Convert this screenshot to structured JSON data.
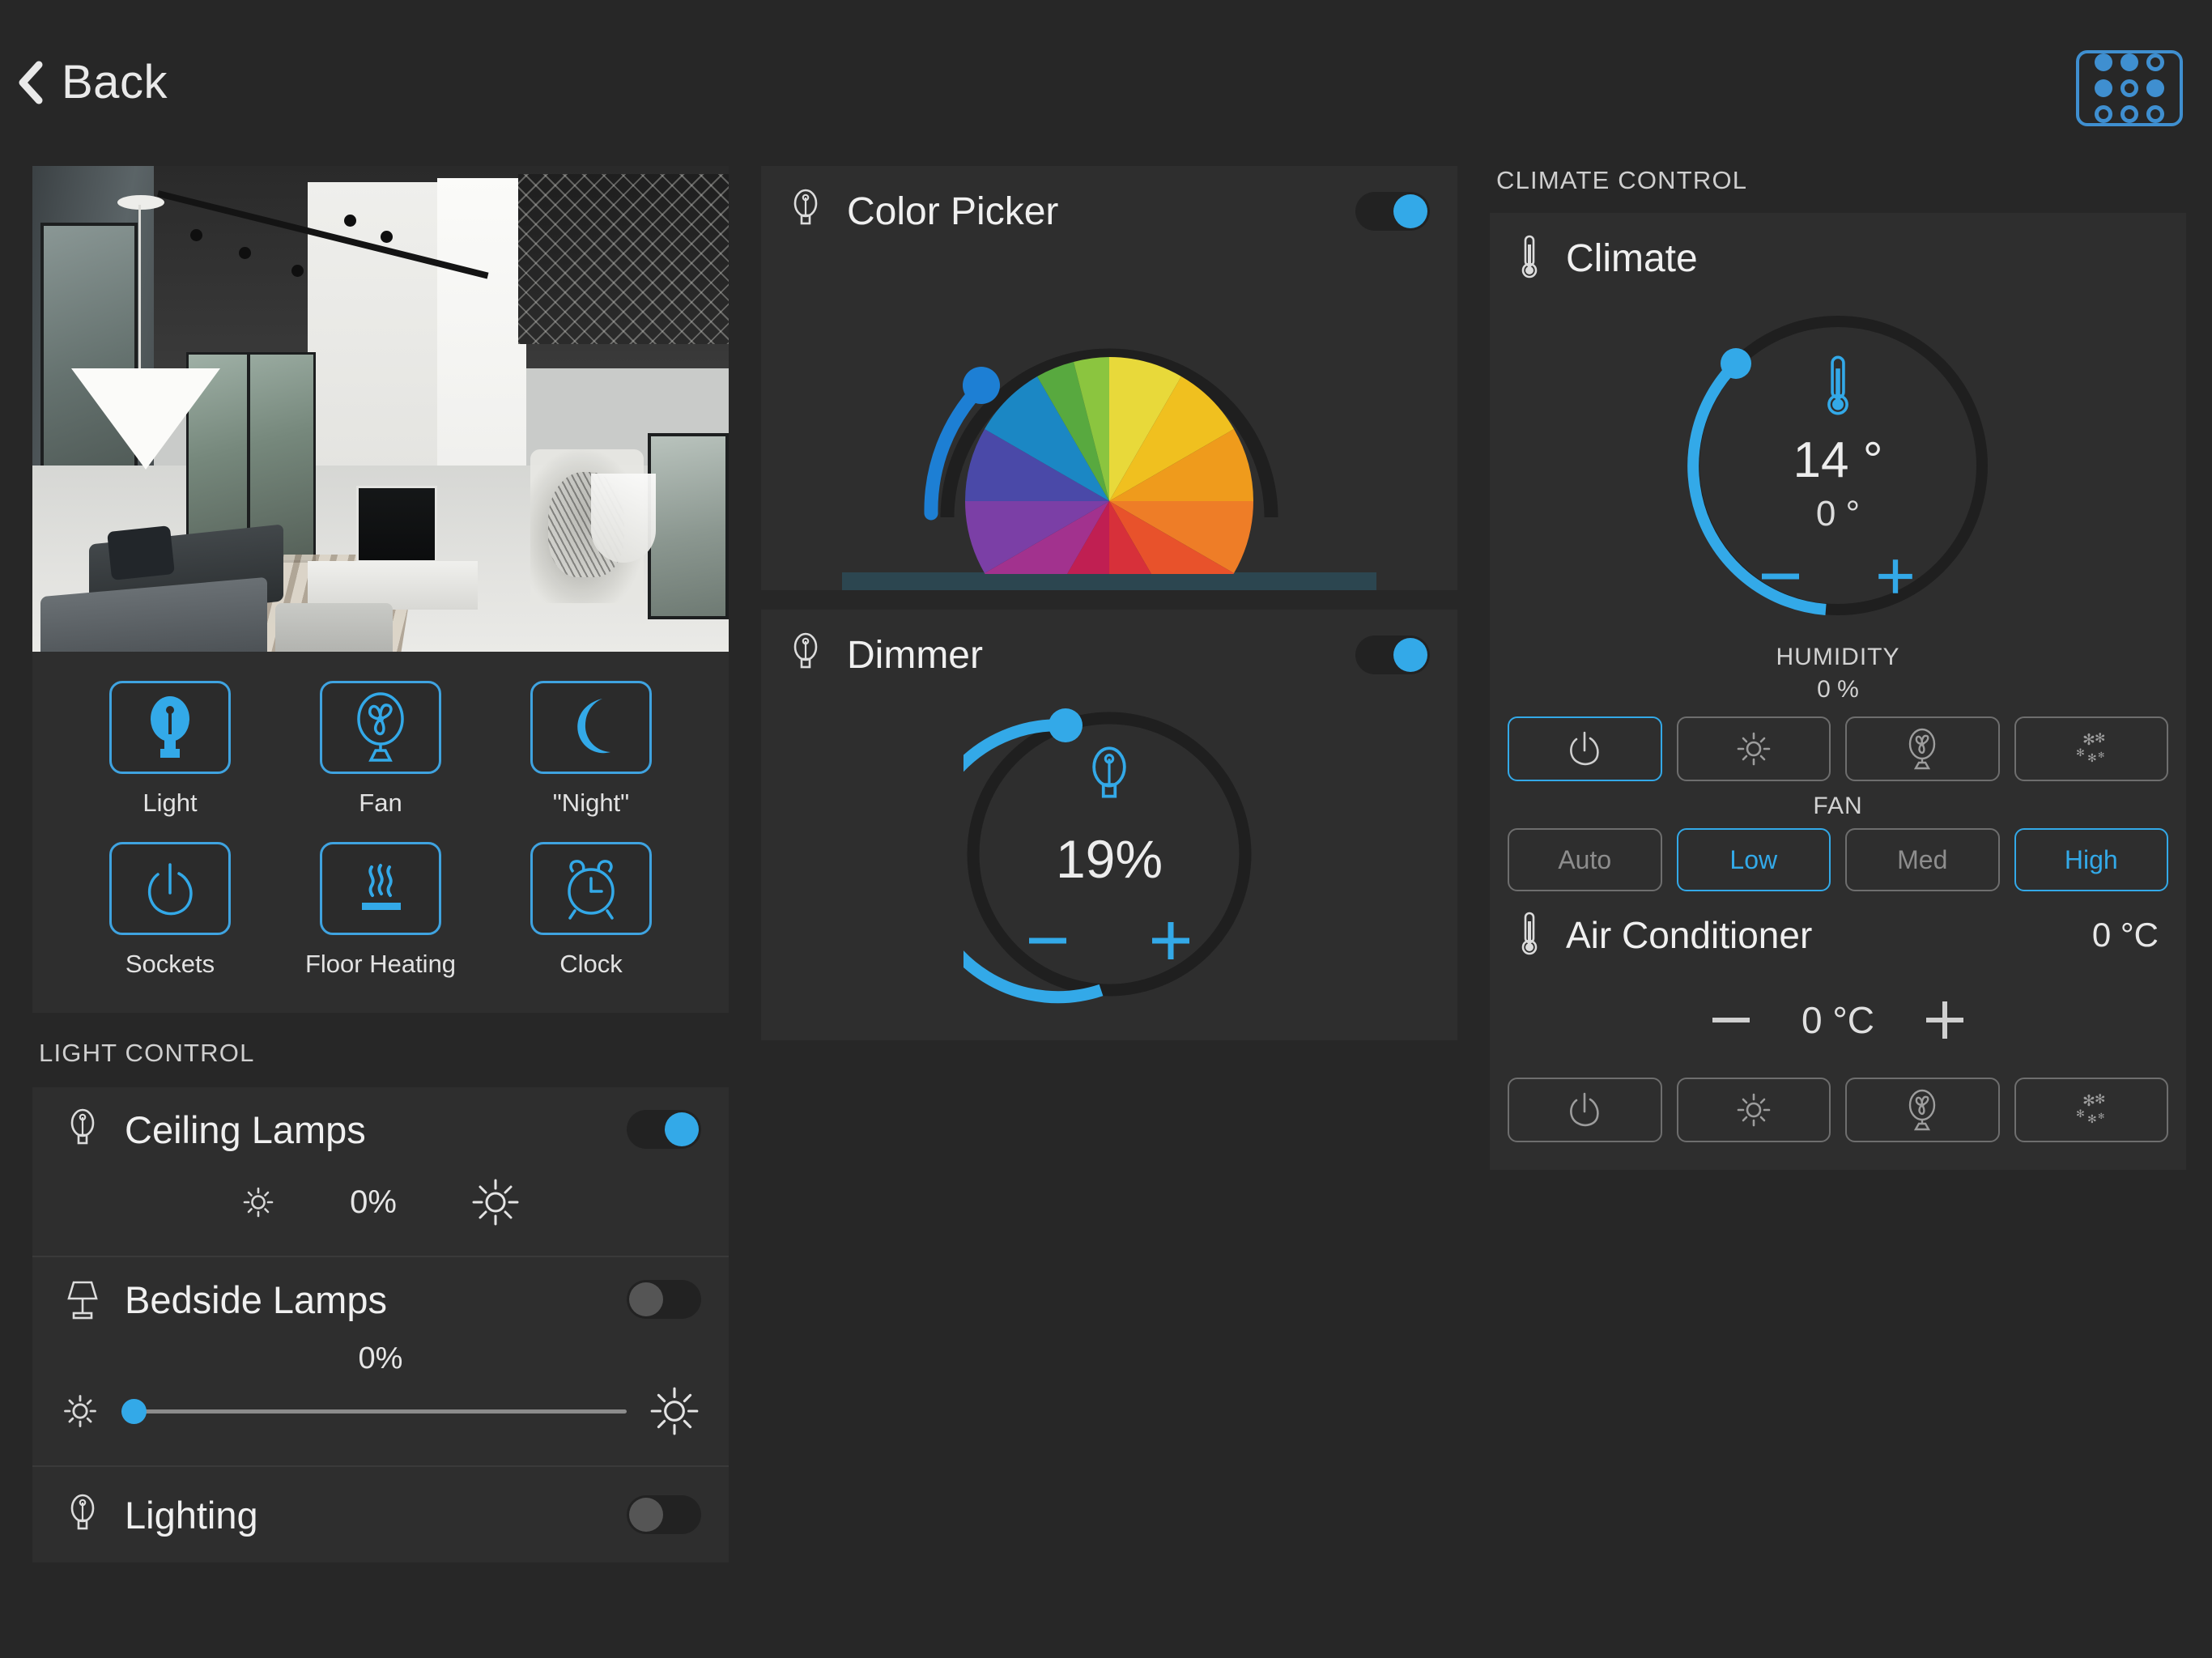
{
  "topbar": {
    "back_label": "Back",
    "back_icon": "chevron-left-icon",
    "grid_icon": "apps-grid-icon",
    "grid_dots": [
      "filled",
      "filled",
      "hollow",
      "filled",
      "hollow",
      "filled",
      "hollow",
      "hollow",
      "hollow"
    ]
  },
  "room_photo": {
    "alt": "modern-living-room-interior",
    "caption": ""
  },
  "quick_actions": [
    {
      "label": "Light",
      "icon": "lightbulb-filled-icon"
    },
    {
      "label": "Fan",
      "icon": "fan-icon"
    },
    {
      "label": "\"Night\"",
      "icon": "moon-icon"
    },
    {
      "label": "Sockets",
      "icon": "power-icon"
    },
    {
      "label": "Floor Heating",
      "icon": "floor-heating-icon"
    },
    {
      "label": "Clock",
      "icon": "alarm-clock-icon"
    }
  ],
  "light_control": {
    "caption": "LIGHT CONTROL",
    "rows": [
      {
        "name": "Ceiling Lamps",
        "icon": "lightbulb-outline-icon",
        "toggle": "on",
        "brightness": "0%",
        "control": "brightness-buttons",
        "dim_low_icon": "brightness-low-icon",
        "dim_high_icon": "brightness-high-icon"
      },
      {
        "name": "Bedside Lamps",
        "icon": "table-lamp-icon",
        "toggle": "off",
        "brightness": "0%",
        "control": "slider",
        "slider_position": 0,
        "dim_low_icon": "brightness-low-icon",
        "dim_high_icon": "brightness-high-icon"
      },
      {
        "name": "Lighting",
        "icon": "lightbulb-outline-icon",
        "toggle": "off",
        "control": "none"
      }
    ]
  },
  "color_picker": {
    "title": "Color Picker",
    "icon": "lightbulb-outline-icon",
    "toggle": "on",
    "wheel_segments": [
      "#e8d93a",
      "#f0c01f",
      "#ef9b1c",
      "#ee7d27",
      "#e8522b",
      "#d7303a",
      "#c01f52",
      "#a2328e",
      "#7b3fa6",
      "#4a49a8",
      "#1b87c4",
      "#58a93f",
      "#8bc53f",
      "#d4d830"
    ],
    "arc_handle_color": "#1d7fd4",
    "arc_track_color": "#1f1f1f",
    "preview_bar_color": "#2c4650"
  },
  "dimmer": {
    "title": "Dimmer",
    "icon": "lightbulb-outline-icon",
    "toggle": "on",
    "value": "19%",
    "value_number": 19,
    "center_icon": "lightbulb-outline-icon",
    "minus_label": "minus-icon",
    "plus_label": "plus-icon",
    "arc_color": "#33a9e8",
    "arc_track_color": "#1f1f1f"
  },
  "climate_control": {
    "caption": "CLIMATE CONTROL",
    "title": "Climate",
    "icon": "thermometer-icon",
    "center_icon": "thermometer-icon",
    "setpoint": "14 °",
    "current": "0 °",
    "minus_label": "minus-icon",
    "plus_label": "plus-icon",
    "humidity_caption": "HUMIDITY",
    "humidity_value": "0 %",
    "mode_buttons": [
      {
        "icon": "power-icon",
        "active": true
      },
      {
        "icon": "sun-icon",
        "active": false
      },
      {
        "icon": "fan-icon",
        "active": false
      },
      {
        "icon": "snowflake-icon",
        "active": false
      }
    ],
    "fan_caption": "FAN",
    "fan_buttons": [
      {
        "label": "Auto",
        "active": false
      },
      {
        "label": "Low",
        "active": true
      },
      {
        "label": "Med",
        "active": false
      },
      {
        "label": "High",
        "active": true
      }
    ],
    "arc_color": "#33a9e8",
    "arc_track_color": "#1f1f1f"
  },
  "air_conditioner": {
    "title": "Air Conditioner",
    "icon": "thermometer-icon",
    "temp_right": "0 °C",
    "stepper_value": "0 °C",
    "minus_label": "minus-icon",
    "plus_label": "plus-icon",
    "mode_buttons": [
      {
        "icon": "power-icon",
        "active": false
      },
      {
        "icon": "sun-icon",
        "active": false
      },
      {
        "icon": "fan-icon",
        "active": false
      },
      {
        "icon": "snowflake-icon",
        "active": false
      }
    ]
  },
  "theme": {
    "background": "#272727",
    "panel": "#2e2e2e",
    "accent": "#33a9e8",
    "accent_border": "#3fa3e0",
    "text": "#e8e8e8",
    "muted": "#8d8d8d"
  }
}
